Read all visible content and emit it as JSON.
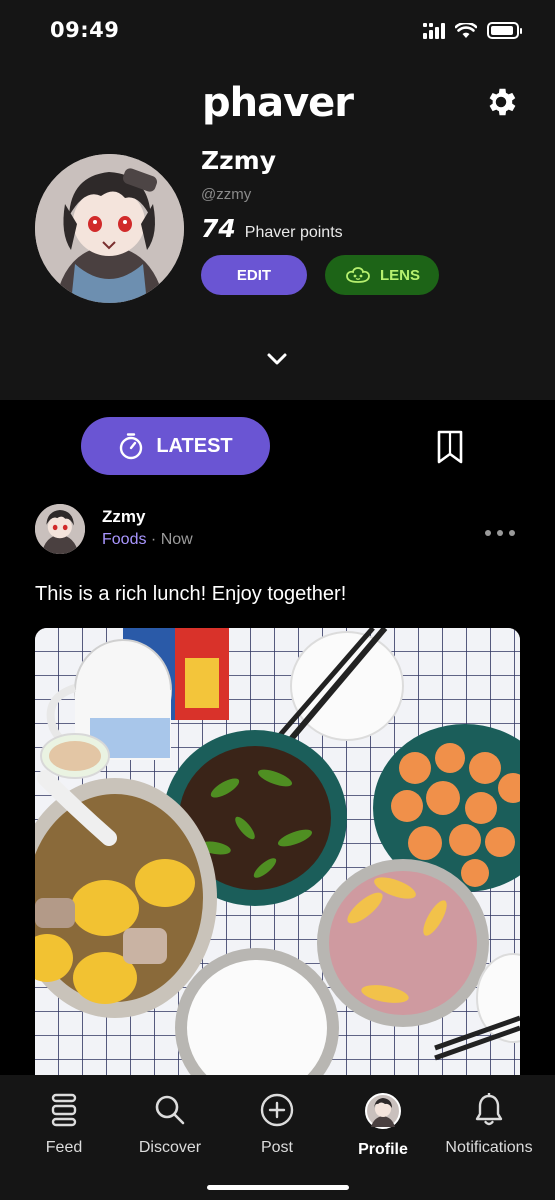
{
  "status": {
    "time": "09:49"
  },
  "header": {
    "logo": "phaver"
  },
  "profile": {
    "name": "Zzmy",
    "handle": "@zzmy",
    "points": "74",
    "points_label": "Phaver points",
    "edit_label": "EDIT",
    "lens_label": "LENS"
  },
  "tabs": {
    "latest_label": "LATEST"
  },
  "post": {
    "author": "Zzmy",
    "category": "Foods",
    "separator": " · ",
    "time": "Now",
    "text": "This is a rich lunch! Enjoy together!"
  },
  "nav": {
    "items": [
      {
        "label": "Feed",
        "icon": "feed-icon"
      },
      {
        "label": "Discover",
        "icon": "search-icon"
      },
      {
        "label": "Post",
        "icon": "plus-circle-icon"
      },
      {
        "label": "Profile",
        "icon": "avatar"
      },
      {
        "label": "Notifications",
        "icon": "bell-icon"
      }
    ],
    "active": "Profile"
  },
  "colors": {
    "accent": "#6a55d3",
    "lens_bg": "#1d6417",
    "lens_text": "#b6f06f",
    "category": "#a996ff"
  }
}
